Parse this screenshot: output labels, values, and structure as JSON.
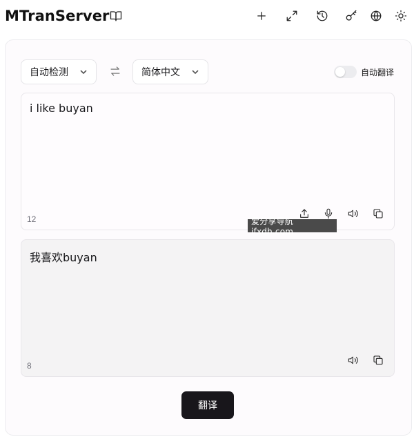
{
  "header": {
    "title": "MTranServer",
    "icons": [
      "book-icon",
      "plus-icon",
      "expand-icon",
      "history-icon",
      "key-icon",
      "globe-icon",
      "sun-icon"
    ]
  },
  "controls": {
    "source_lang": "自动检测",
    "target_lang": "简体中文",
    "auto_translate_label": "自动翻译",
    "auto_translate_on": false
  },
  "source": {
    "text": "i like buyan",
    "count": "12"
  },
  "target": {
    "text": "我喜欢buyan",
    "count": "8"
  },
  "watermark": "爱分享导航 ifxdh.com",
  "actions": {
    "translate_label": "翻译"
  }
}
